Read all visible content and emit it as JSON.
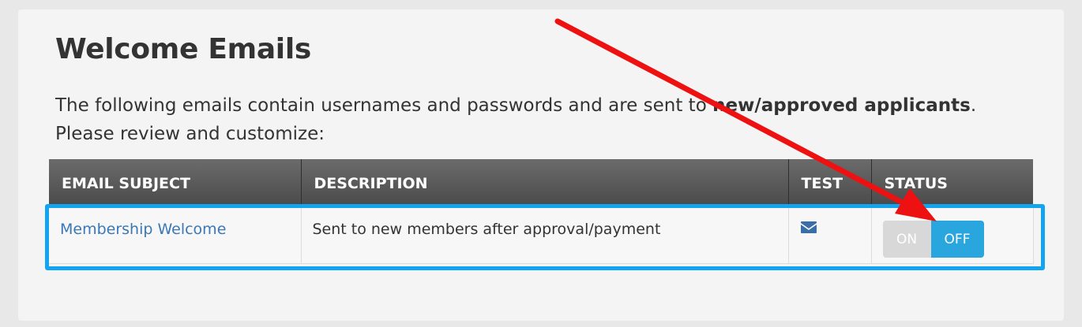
{
  "page": {
    "title": "Welcome Emails",
    "intro_text": "The following emails contain usernames and passwords and are sent to ",
    "intro_bold": "new/approved applicants",
    "intro_end": ".",
    "intro_line2": "Please review and customize:"
  },
  "table": {
    "headers": [
      "EMAIL SUBJECT",
      "DESCRIPTION",
      "TEST",
      "STATUS"
    ],
    "rows": [
      {
        "subject": "Membership Welcome",
        "description": "Sent to new members after approval/payment",
        "test_icon": "envelope-icon",
        "status_on_label": "ON",
        "status_off_label": "OFF",
        "status_selected": "OFF"
      }
    ]
  },
  "annotations": {
    "highlight_color": "#13a4f0",
    "arrow_color": "#ee1111"
  },
  "colors": {
    "link": "#3a78b5",
    "toggle_active": "#2aa6df",
    "toggle_inactive": "#d8d8d8",
    "header_bg": "#555555"
  }
}
